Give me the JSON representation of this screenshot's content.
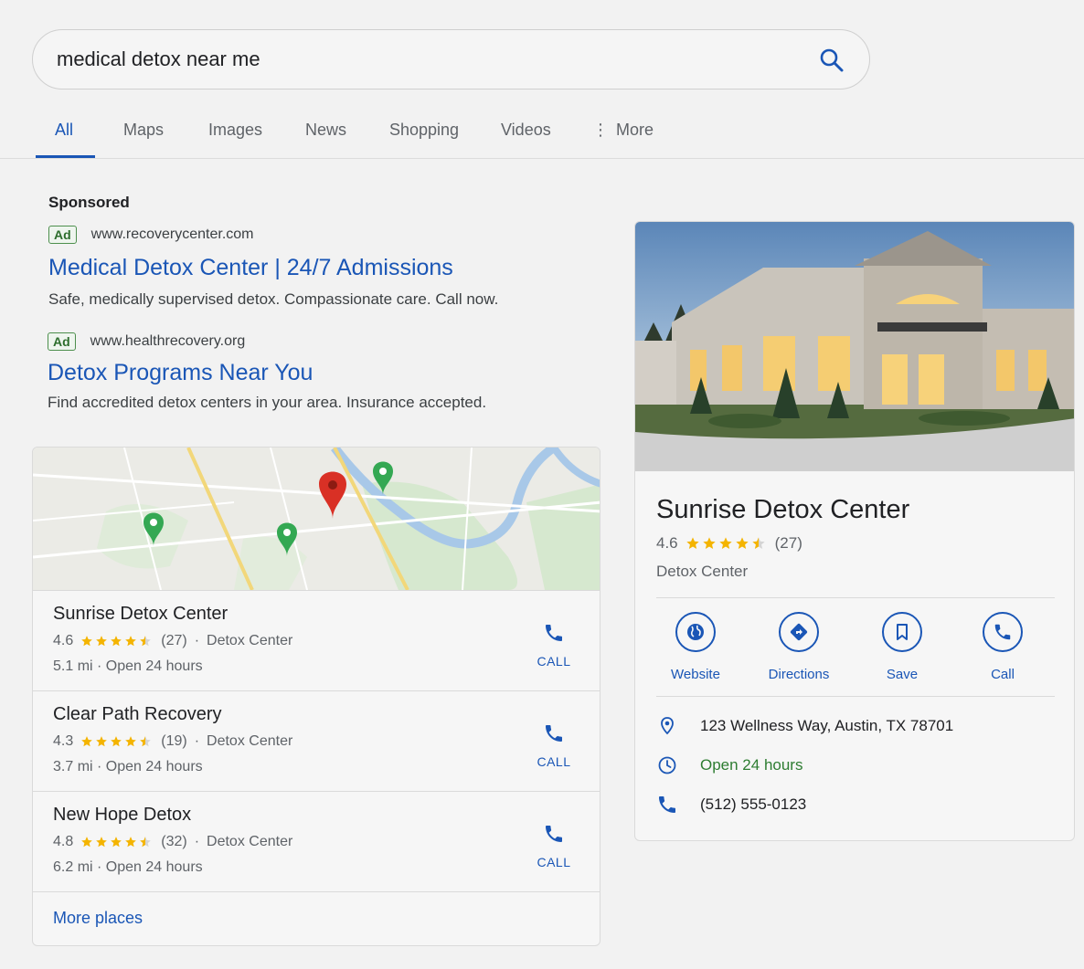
{
  "search": {
    "query": "medical detox near me"
  },
  "tabs": [
    {
      "label": "All",
      "active": true
    },
    {
      "label": "Maps"
    },
    {
      "label": "Images"
    },
    {
      "label": "News"
    },
    {
      "label": "Shopping"
    },
    {
      "label": "Videos"
    },
    {
      "label": "More"
    }
  ],
  "sponsored": {
    "label": "Sponsored",
    "ads": [
      {
        "badge": "Ad",
        "url": "www.recoverycenter.com",
        "title": "Medical Detox Center | 24/7 Admissions",
        "description": "Safe, medically supervised detox. Compassionate care. Call now."
      },
      {
        "badge": "Ad",
        "url": "www.healthrecovery.org",
        "title": "Detox Programs Near You",
        "description": "Find accredited detox centers in your area. Insurance accepted."
      }
    ]
  },
  "local_pack": {
    "places": [
      {
        "name": "Sunrise Detox Center",
        "rating": "4.6",
        "stars": 4.5,
        "reviews": "(27)",
        "category": "Detox Center",
        "meta": "5.1 mi · Open 24 hours",
        "call_label": "CALL"
      },
      {
        "name": "Clear Path Recovery",
        "rating": "4.3",
        "stars": 4.5,
        "reviews": "(19)",
        "category": "Detox Center",
        "meta": "3.7 mi · Open 24 hours",
        "call_label": "CALL"
      },
      {
        "name": "New Hope Detox",
        "rating": "4.8",
        "stars": 4.5,
        "reviews": "(32)",
        "category": "Detox Center",
        "meta": "6.2 mi · Open 24 hours",
        "call_label": "CALL"
      }
    ],
    "more_label": "More places"
  },
  "knowledge_panel": {
    "title": "Sunrise Detox Center",
    "rating": "4.6",
    "stars": 4.5,
    "reviews": "(27)",
    "category": "Detox Center",
    "actions": [
      {
        "label": "Website",
        "icon": "globe-icon"
      },
      {
        "label": "Directions",
        "icon": "directions-icon"
      },
      {
        "label": "Save",
        "icon": "bookmark-icon"
      },
      {
        "label": "Call",
        "icon": "phone-icon"
      }
    ],
    "address": "123 Wellness Way, Austin, TX 78701",
    "hours": "Open 24 hours",
    "phone": "(512) 555-0123"
  },
  "colors": {
    "link": "#1a56b6",
    "star": "#f4b400",
    "open_green": "#2e7d32",
    "pin_red": "#d93025",
    "pin_green": "#34a853"
  }
}
